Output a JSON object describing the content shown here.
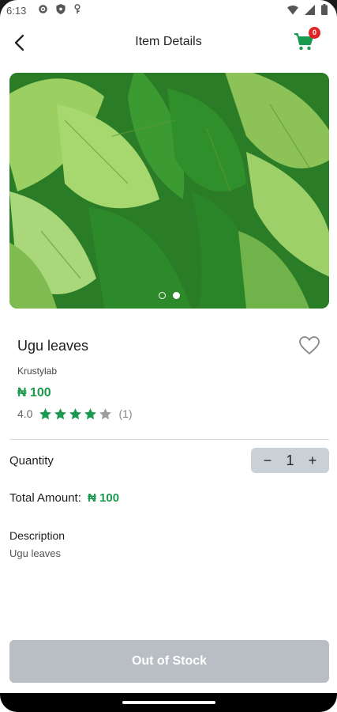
{
  "status_bar": {
    "time": "6:13"
  },
  "header": {
    "title": "Item Details",
    "cart_count": "0"
  },
  "product": {
    "name": "Ugu leaves",
    "vendor": "Krustylab",
    "price": "₦ 100",
    "rating": "4.0",
    "rating_stars": 4,
    "rating_max": 5,
    "review_count": "(1)",
    "carousel_active_index": 2,
    "carousel_total": 2
  },
  "quantity": {
    "label": "Quantity",
    "value": "1",
    "minus": "−",
    "plus": "+"
  },
  "total": {
    "label": "Total Amount:",
    "value": "₦ 100"
  },
  "description": {
    "title": "Description",
    "text": "Ugu leaves"
  },
  "cta": {
    "label": "Out of Stock"
  },
  "colors": {
    "accent": "#1a9a4e",
    "badge": "#e02424",
    "disabled_button": "#b8bec4"
  }
}
